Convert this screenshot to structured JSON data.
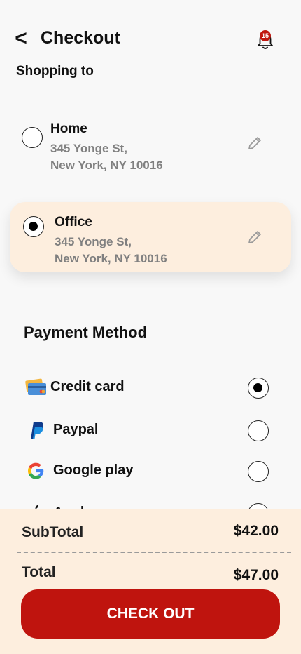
{
  "header": {
    "back_glyph": "<",
    "title": "Checkout",
    "notification_count": "15"
  },
  "shipping": {
    "label": "Shopping to",
    "addresses": [
      {
        "name": "Home",
        "line1": "345 Yonge St,",
        "line2": "New York, NY 10016",
        "selected": false
      },
      {
        "name": "Office",
        "line1": "345 Yonge St,",
        "line2": "New York, NY 10016",
        "selected": true
      }
    ]
  },
  "payment": {
    "title": "Payment Method",
    "methods": [
      {
        "label": "Credit card",
        "icon": "credit-card-icon",
        "selected": true
      },
      {
        "label": "Paypal",
        "icon": "paypal-icon",
        "selected": false
      },
      {
        "label": "Google play",
        "icon": "google-icon",
        "selected": false
      },
      {
        "label": "Apple",
        "icon": "apple-icon",
        "selected": false
      }
    ]
  },
  "summary": {
    "subtotal_label": "SubTotal",
    "subtotal_value": "$42.00",
    "total_label": "Total",
    "total_value": "$47.00"
  },
  "checkout_button": "CHECK OUT",
  "colors": {
    "accent": "#bf140e",
    "highlight_bg": "#fdeede",
    "muted_text": "#808080"
  }
}
